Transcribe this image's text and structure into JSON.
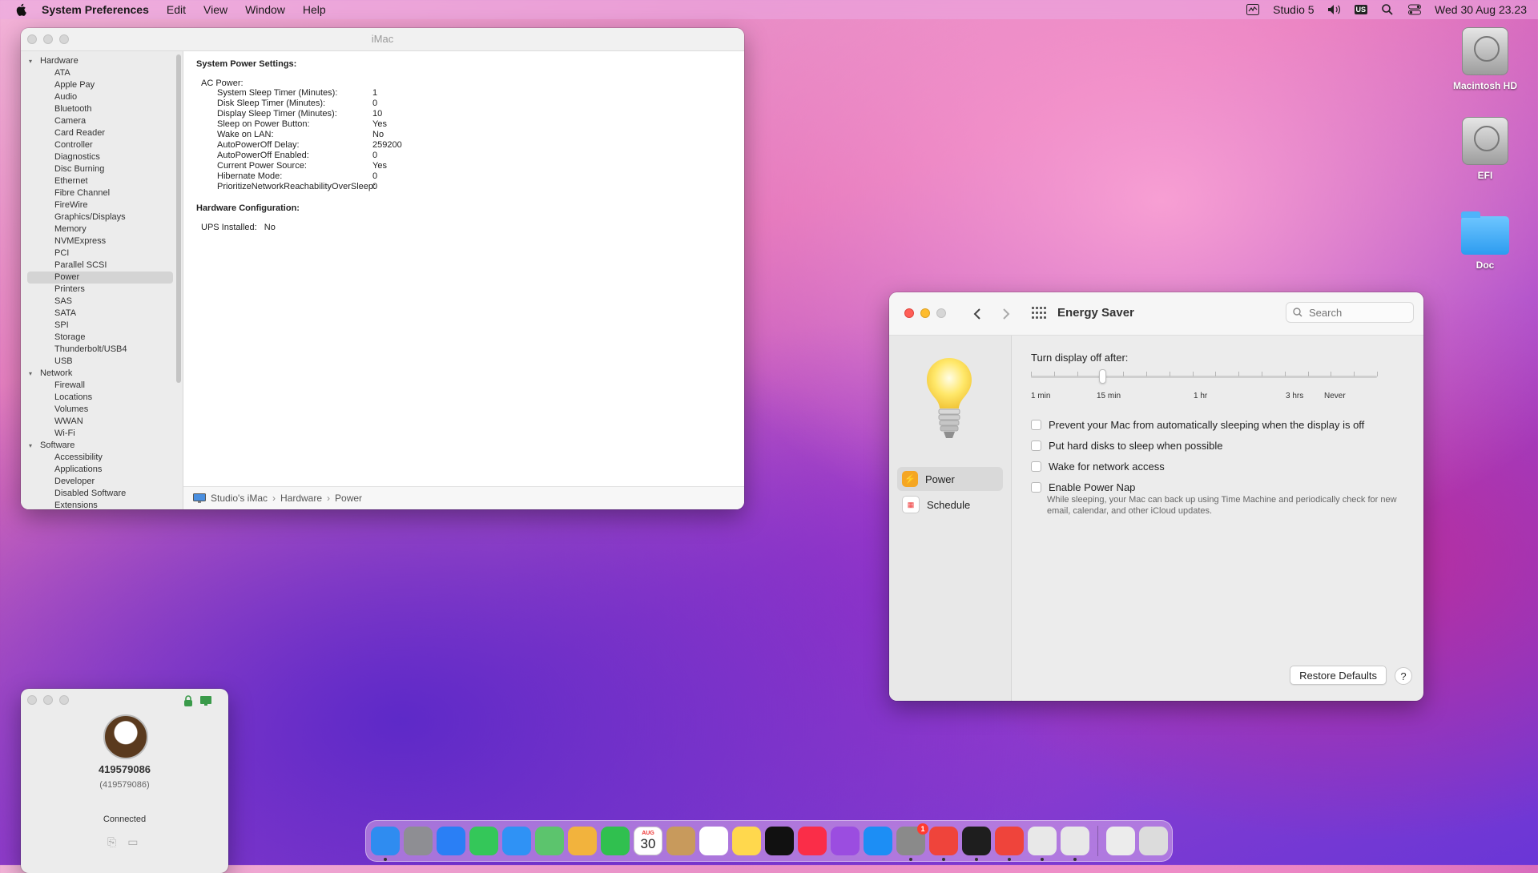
{
  "menubar": {
    "app_name": "System Preferences",
    "menus": [
      "Edit",
      "View",
      "Window",
      "Help"
    ],
    "user": "Studio 5",
    "keyboard": "US",
    "clock": "Wed 30 Aug  23.23"
  },
  "sysinfo": {
    "title": "iMac",
    "tree": [
      {
        "category": "Hardware",
        "items": [
          "ATA",
          "Apple Pay",
          "Audio",
          "Bluetooth",
          "Camera",
          "Card Reader",
          "Controller",
          "Diagnostics",
          "Disc Burning",
          "Ethernet",
          "Fibre Channel",
          "FireWire",
          "Graphics/Displays",
          "Memory",
          "NVMExpress",
          "PCI",
          "Parallel SCSI",
          "Power",
          "Printers",
          "SAS",
          "SATA",
          "SPI",
          "Storage",
          "Thunderbolt/USB4",
          "USB"
        ]
      },
      {
        "category": "Network",
        "items": [
          "Firewall",
          "Locations",
          "Volumes",
          "WWAN",
          "Wi-Fi"
        ]
      },
      {
        "category": "Software",
        "items": [
          "Accessibility",
          "Applications",
          "Developer",
          "Disabled Software",
          "Extensions"
        ]
      }
    ],
    "selected_item": "Power",
    "power_settings_title": "System Power Settings:",
    "ac_power_label": "AC Power:",
    "settings": [
      {
        "key": "System Sleep Timer (Minutes):",
        "value": "1"
      },
      {
        "key": "Disk Sleep Timer (Minutes):",
        "value": "0"
      },
      {
        "key": "Display Sleep Timer (Minutes):",
        "value": "10"
      },
      {
        "key": "Sleep on Power Button:",
        "value": "Yes"
      },
      {
        "key": "Wake on LAN:",
        "value": "No"
      },
      {
        "key": "AutoPowerOff Delay:",
        "value": "259200"
      },
      {
        "key": "AutoPowerOff Enabled:",
        "value": "0"
      },
      {
        "key": "Current Power Source:",
        "value": "Yes"
      },
      {
        "key": "Hibernate Mode:",
        "value": "0"
      },
      {
        "key": "PrioritizeNetworkReachabilityOverSleep:",
        "value": "0"
      }
    ],
    "hw_config_title": "Hardware Configuration:",
    "ups_label": "UPS Installed:",
    "ups_value": "No",
    "breadcrumb": [
      "Studio's iMac",
      "Hardware",
      "Power"
    ]
  },
  "energy": {
    "title": "Energy Saver",
    "search_placeholder": "Search",
    "nav": [
      {
        "label": "Power",
        "active": true
      },
      {
        "label": "Schedule",
        "active": false
      }
    ],
    "slider_label": "Turn display off after:",
    "slider_value_fraction": 0.205,
    "tick_labels": [
      "1 min",
      "15 min",
      "1 hr",
      "3 hrs",
      "Never"
    ],
    "options": [
      {
        "label": "Prevent your Mac from automatically sleeping when the display is off",
        "checked": false
      },
      {
        "label": "Put hard disks to sleep when possible",
        "checked": false
      },
      {
        "label": "Wake for network access",
        "checked": false
      },
      {
        "label": "Enable Power Nap",
        "checked": false
      }
    ],
    "power_nap_note": "While sleeping, your Mac can back up using Time Machine and periodically check for new email, calendar, and other iCloud updates.",
    "restore_label": "Restore Defaults",
    "help_label": "?"
  },
  "remote": {
    "id": "419579086",
    "sub_id": "(419579086)",
    "status": "Connected"
  },
  "desktop": {
    "icons": [
      "Macintosh HD",
      "EFI",
      "Doc"
    ]
  },
  "dock": {
    "calendar_month": "AUG",
    "calendar_day": "30",
    "settings_badge": "1",
    "apps": [
      {
        "name": "finder-icon",
        "color": "#2f8cf0"
      },
      {
        "name": "launchpad-icon",
        "color": "#8e8e93"
      },
      {
        "name": "safari-icon",
        "color": "#2a7ff5"
      },
      {
        "name": "messages-icon",
        "color": "#34c759"
      },
      {
        "name": "mail-icon",
        "color": "#2f92f5"
      },
      {
        "name": "maps-icon",
        "color": "#5cc46d"
      },
      {
        "name": "photos-icon",
        "color": "#f2b33d"
      },
      {
        "name": "facetime-icon",
        "color": "#30c04f"
      },
      {
        "name": "calendar-icon",
        "color": "#ffffff"
      },
      {
        "name": "contacts-icon",
        "color": "#c89a5c"
      },
      {
        "name": "reminders-icon",
        "color": "#ffffff"
      },
      {
        "name": "notes-icon",
        "color": "#ffd84d"
      },
      {
        "name": "appletv-icon",
        "color": "#111111"
      },
      {
        "name": "music-icon",
        "color": "#fa2d48"
      },
      {
        "name": "podcasts-icon",
        "color": "#9b4de0"
      },
      {
        "name": "appstore-icon",
        "color": "#1c8ef5"
      },
      {
        "name": "system-preferences-icon",
        "color": "#8a8a8a"
      },
      {
        "name": "anydesk-icon",
        "color": "#ef443b"
      },
      {
        "name": "terminal-icon",
        "color": "#1e1e1e"
      },
      {
        "name": "anydesk-remote-icon",
        "color": "#ef443b"
      },
      {
        "name": "script-editor-icon",
        "color": "#e8e8e8"
      },
      {
        "name": "printer-icon",
        "color": "#e8e8e8"
      },
      {
        "name": "downloads-icon",
        "color": "#ececec"
      },
      {
        "name": "trash-icon",
        "color": "#dcdcdc"
      }
    ]
  }
}
